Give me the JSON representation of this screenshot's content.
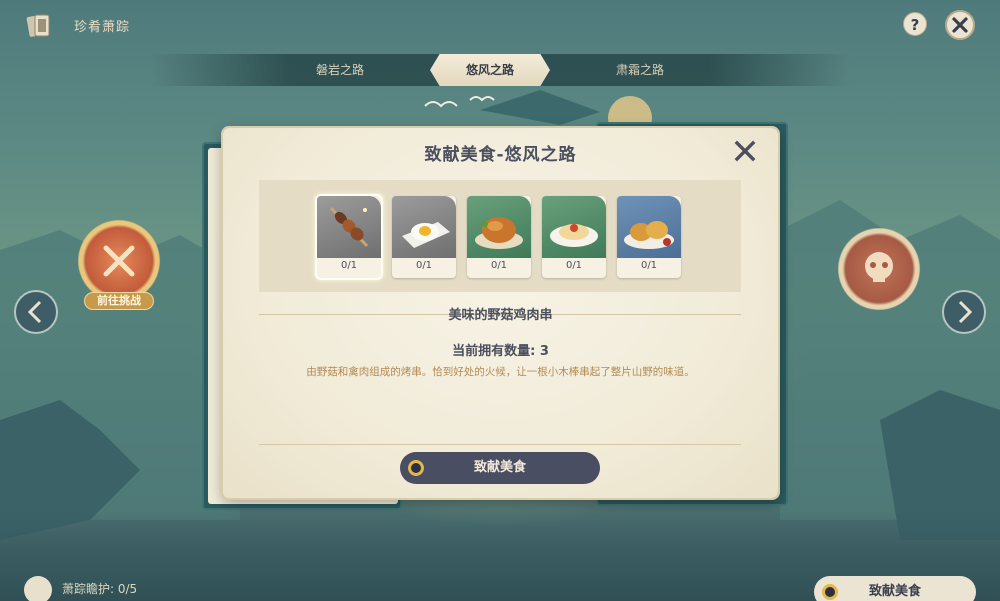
{
  "header": {
    "title": "珍肴萧踪"
  },
  "tabs": [
    {
      "label": "磐岩之路",
      "active": false
    },
    {
      "label": "悠风之路",
      "active": true
    },
    {
      "label": "肃霜之路",
      "active": false
    }
  ],
  "map": {
    "left_node_label": "前往挑战"
  },
  "dialog": {
    "title": "致献美食-悠风之路",
    "items": [
      {
        "count": "0/1",
        "icon": "mushroom-skewer-icon",
        "color": "#8a8a8a",
        "selected": true
      },
      {
        "count": "0/1",
        "icon": "fried-egg-icon",
        "color": "#8a8a8a",
        "selected": false
      },
      {
        "count": "0/1",
        "icon": "roast-chicken-icon",
        "color": "#5f8f6e",
        "selected": false
      },
      {
        "count": "0/1",
        "icon": "pasta-icon",
        "color": "#5f8f6e",
        "selected": false
      },
      {
        "count": "0/1",
        "icon": "fried-cutlet-icon",
        "color": "#5a7ea6",
        "selected": false
      }
    ],
    "food_name": "美味的野菇鸡肉串",
    "owned": "当前拥有数量: 3",
    "description": "由野菇和禽肉组成的烤串。恰到好处的火候，让一根小木棒串起了整片山野的味道。",
    "donate_label": "致献美食"
  },
  "footer": {
    "status": "萧踪瞻护: 0/5",
    "donate_label": "致献美食"
  },
  "colors": {
    "button_dark": "#4a4e62",
    "accent_gold": "#e2b84a",
    "panel_cream": "#f1ebd8"
  }
}
